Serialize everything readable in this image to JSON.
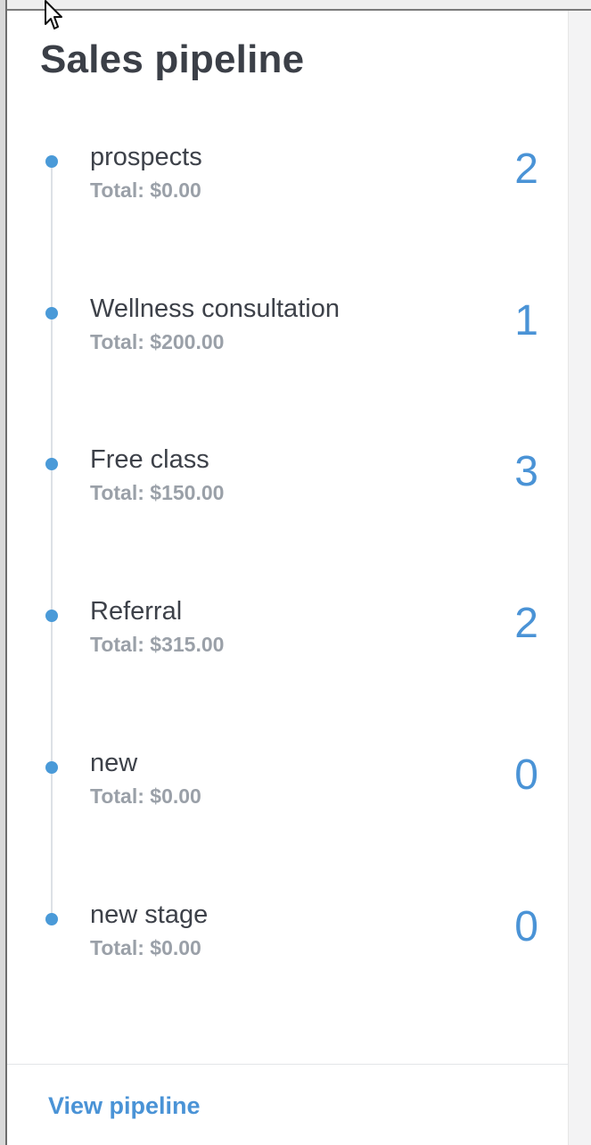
{
  "panel": {
    "title": "Sales pipeline",
    "footer_link": "View pipeline"
  },
  "stages": [
    {
      "name": "prospects",
      "total": "Total: $0.00",
      "count": "2"
    },
    {
      "name": "Wellness consultation",
      "total": "Total: $200.00",
      "count": "1"
    },
    {
      "name": "Free class",
      "total": "Total: $150.00",
      "count": "3"
    },
    {
      "name": "Referral",
      "total": "Total: $315.00",
      "count": "2"
    },
    {
      "name": "new",
      "total": "Total: $0.00",
      "count": "0"
    },
    {
      "name": "new stage",
      "total": "Total: $0.00",
      "count": "0"
    }
  ],
  "icons": {
    "cursor": "mouse-pointer-icon",
    "stage_marker": "timeline-dot-icon"
  },
  "colors": {
    "accent": "#4a93d6",
    "title": "#3b3f47",
    "muted": "#9aa0a8",
    "dot": "#4a9ad8"
  }
}
